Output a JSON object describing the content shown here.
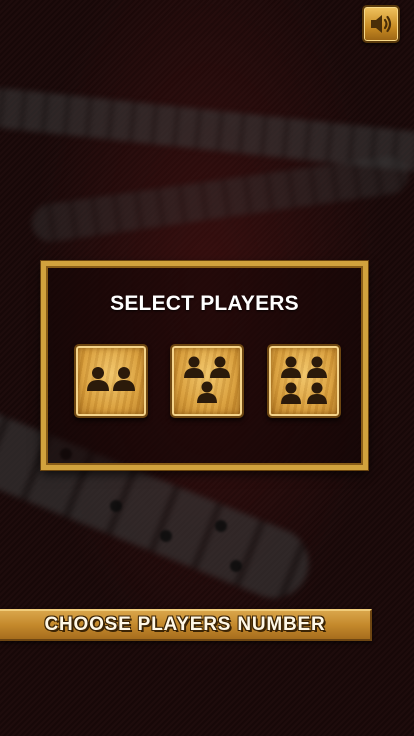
{
  "header": {
    "sound_icon": "speaker-volume-icon"
  },
  "panel": {
    "title": "SELECT PLAYERS",
    "options": [
      {
        "players": 2,
        "icon": "two-players-icon"
      },
      {
        "players": 3,
        "icon": "three-players-icon"
      },
      {
        "players": 4,
        "icon": "four-players-icon"
      }
    ]
  },
  "banner": {
    "text": "CHOOSE PLAYERS NUMBER"
  },
  "colors": {
    "gold": "#d1a23d",
    "wood": "#d89d3a",
    "person": "#2b1a0a",
    "background": "#1a0909"
  }
}
